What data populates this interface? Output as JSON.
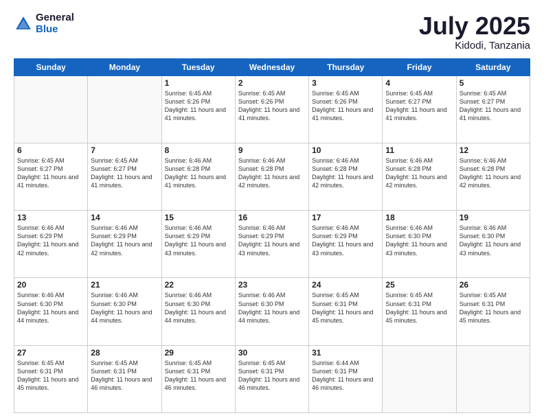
{
  "header": {
    "logo_general": "General",
    "logo_blue": "Blue",
    "title": "July 2025",
    "location": "Kidodi, Tanzania"
  },
  "weekdays": [
    "Sunday",
    "Monday",
    "Tuesday",
    "Wednesday",
    "Thursday",
    "Friday",
    "Saturday"
  ],
  "weeks": [
    [
      {
        "day": "",
        "info": ""
      },
      {
        "day": "",
        "info": ""
      },
      {
        "day": "1",
        "info": "Sunrise: 6:45 AM\nSunset: 6:26 PM\nDaylight: 11 hours and 41 minutes."
      },
      {
        "day": "2",
        "info": "Sunrise: 6:45 AM\nSunset: 6:26 PM\nDaylight: 11 hours and 41 minutes."
      },
      {
        "day": "3",
        "info": "Sunrise: 6:45 AM\nSunset: 6:26 PM\nDaylight: 11 hours and 41 minutes."
      },
      {
        "day": "4",
        "info": "Sunrise: 6:45 AM\nSunset: 6:27 PM\nDaylight: 11 hours and 41 minutes."
      },
      {
        "day": "5",
        "info": "Sunrise: 6:45 AM\nSunset: 6:27 PM\nDaylight: 11 hours and 41 minutes."
      }
    ],
    [
      {
        "day": "6",
        "info": "Sunrise: 6:45 AM\nSunset: 6:27 PM\nDaylight: 11 hours and 41 minutes."
      },
      {
        "day": "7",
        "info": "Sunrise: 6:45 AM\nSunset: 6:27 PM\nDaylight: 11 hours and 41 minutes."
      },
      {
        "day": "8",
        "info": "Sunrise: 6:46 AM\nSunset: 6:28 PM\nDaylight: 11 hours and 41 minutes."
      },
      {
        "day": "9",
        "info": "Sunrise: 6:46 AM\nSunset: 6:28 PM\nDaylight: 11 hours and 42 minutes."
      },
      {
        "day": "10",
        "info": "Sunrise: 6:46 AM\nSunset: 6:28 PM\nDaylight: 11 hours and 42 minutes."
      },
      {
        "day": "11",
        "info": "Sunrise: 6:46 AM\nSunset: 6:28 PM\nDaylight: 11 hours and 42 minutes."
      },
      {
        "day": "12",
        "info": "Sunrise: 6:46 AM\nSunset: 6:28 PM\nDaylight: 11 hours and 42 minutes."
      }
    ],
    [
      {
        "day": "13",
        "info": "Sunrise: 6:46 AM\nSunset: 6:29 PM\nDaylight: 11 hours and 42 minutes."
      },
      {
        "day": "14",
        "info": "Sunrise: 6:46 AM\nSunset: 6:29 PM\nDaylight: 11 hours and 42 minutes."
      },
      {
        "day": "15",
        "info": "Sunrise: 6:46 AM\nSunset: 6:29 PM\nDaylight: 11 hours and 43 minutes."
      },
      {
        "day": "16",
        "info": "Sunrise: 6:46 AM\nSunset: 6:29 PM\nDaylight: 11 hours and 43 minutes."
      },
      {
        "day": "17",
        "info": "Sunrise: 6:46 AM\nSunset: 6:29 PM\nDaylight: 11 hours and 43 minutes."
      },
      {
        "day": "18",
        "info": "Sunrise: 6:46 AM\nSunset: 6:30 PM\nDaylight: 11 hours and 43 minutes."
      },
      {
        "day": "19",
        "info": "Sunrise: 6:46 AM\nSunset: 6:30 PM\nDaylight: 11 hours and 43 minutes."
      }
    ],
    [
      {
        "day": "20",
        "info": "Sunrise: 6:46 AM\nSunset: 6:30 PM\nDaylight: 11 hours and 44 minutes."
      },
      {
        "day": "21",
        "info": "Sunrise: 6:46 AM\nSunset: 6:30 PM\nDaylight: 11 hours and 44 minutes."
      },
      {
        "day": "22",
        "info": "Sunrise: 6:46 AM\nSunset: 6:30 PM\nDaylight: 11 hours and 44 minutes."
      },
      {
        "day": "23",
        "info": "Sunrise: 6:46 AM\nSunset: 6:30 PM\nDaylight: 11 hours and 44 minutes."
      },
      {
        "day": "24",
        "info": "Sunrise: 6:45 AM\nSunset: 6:31 PM\nDaylight: 11 hours and 45 minutes."
      },
      {
        "day": "25",
        "info": "Sunrise: 6:45 AM\nSunset: 6:31 PM\nDaylight: 11 hours and 45 minutes."
      },
      {
        "day": "26",
        "info": "Sunrise: 6:45 AM\nSunset: 6:31 PM\nDaylight: 11 hours and 45 minutes."
      }
    ],
    [
      {
        "day": "27",
        "info": "Sunrise: 6:45 AM\nSunset: 6:31 PM\nDaylight: 11 hours and 45 minutes."
      },
      {
        "day": "28",
        "info": "Sunrise: 6:45 AM\nSunset: 6:31 PM\nDaylight: 11 hours and 46 minutes."
      },
      {
        "day": "29",
        "info": "Sunrise: 6:45 AM\nSunset: 6:31 PM\nDaylight: 11 hours and 46 minutes."
      },
      {
        "day": "30",
        "info": "Sunrise: 6:45 AM\nSunset: 6:31 PM\nDaylight: 11 hours and 46 minutes."
      },
      {
        "day": "31",
        "info": "Sunrise: 6:44 AM\nSunset: 6:31 PM\nDaylight: 11 hours and 46 minutes."
      },
      {
        "day": "",
        "info": ""
      },
      {
        "day": "",
        "info": ""
      }
    ]
  ]
}
